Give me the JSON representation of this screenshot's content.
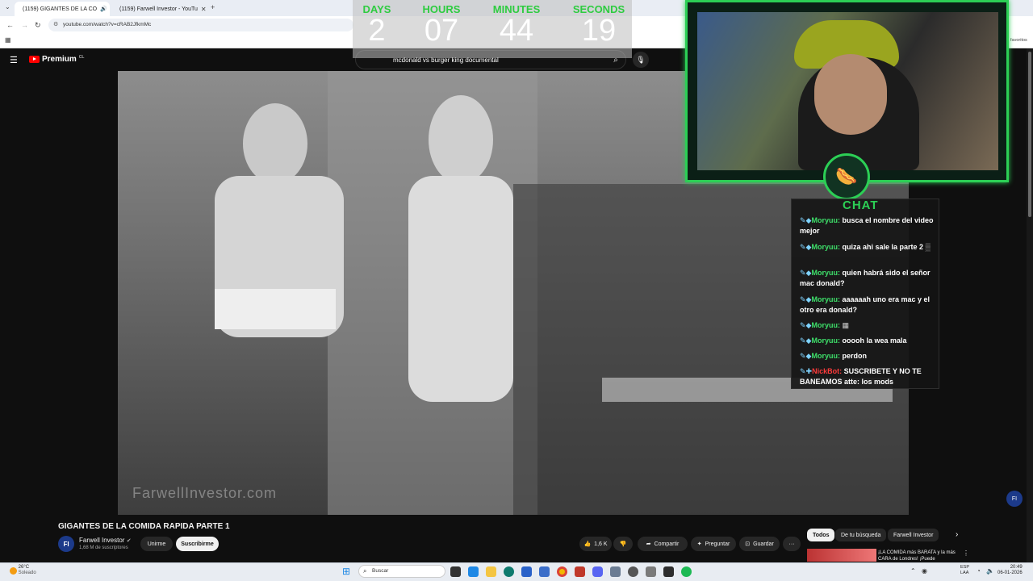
{
  "browser": {
    "tabs": [
      {
        "label": "(1159) GIGANTES DE LA CO"
      },
      {
        "label": "(1159) Farwell Investor - YouTu"
      }
    ],
    "url": "youtube.com/watch?v=cRAB2JfkmMc",
    "bookmarks_right": "favoritos"
  },
  "youtube": {
    "logo_label": "Premium",
    "logo_region": "CL",
    "search_value": "mcdonald vs burger king documental"
  },
  "countdown": {
    "days_label": "DAYS",
    "hours_label": "HOURS",
    "minutes_label": "MINUTES",
    "seconds_label": "SECONDS",
    "days": "2",
    "hours": "07",
    "minutes": "44",
    "seconds": "19"
  },
  "video": {
    "watermark": "FarwellInvestor.com"
  },
  "chat": {
    "title": "CHAT",
    "messages": [
      {
        "user": "Moryuu:",
        "text": "busca el nombre del video mejor"
      },
      {
        "user": "Moryuu:",
        "text": "quiza ahi sale la parte 2"
      },
      {
        "user": "Moryuu:",
        "text": "quien habrá sido el señor mac donald?"
      },
      {
        "user": "Moryuu:",
        "text": "aaaaaah uno era mac y el otro era donald?"
      },
      {
        "user": "Moryuu:",
        "text": ""
      },
      {
        "user": "Moryuu:",
        "text": "ooooh la wea mala"
      },
      {
        "user": "Moryuu:",
        "text": "perdon"
      },
      {
        "user": "NickBot:",
        "text": "SUSCRIBETE Y NO TE BANEAMOS atte: los mods"
      }
    ]
  },
  "below_video": {
    "title": "GIGANTES DE LA COMIDA RAPIDA PARTE 1",
    "channel_avatar": "FI",
    "channel_name": "Farwell Investor",
    "subscribers": "1,68 M de suscriptores",
    "join_label": "Unirme",
    "subscribe_label": "Suscribirme",
    "likes": "1,6 K",
    "share_label": "Compartir",
    "ask_label": "Preguntar",
    "save_label": "Guardar",
    "more_label": "···"
  },
  "chips": [
    "Todos",
    "De tu búsqueda",
    "Farwell Investor"
  ],
  "related": {
    "title": "¡LA COMIDA más BARATA y la más CARA de Londres! ¡Puede"
  },
  "taskbar": {
    "weather_temp": "26°C",
    "weather_desc": "Soleado",
    "search_placeholder": "Buscar",
    "lang_line1": "ESP",
    "lang_line2": "LAA",
    "time": "20:49",
    "date": "06-01-2026"
  },
  "colors": {
    "accent_green": "#2ccf55",
    "youtube_red": "#ff0000",
    "bg_dark": "#0f0f0f"
  }
}
